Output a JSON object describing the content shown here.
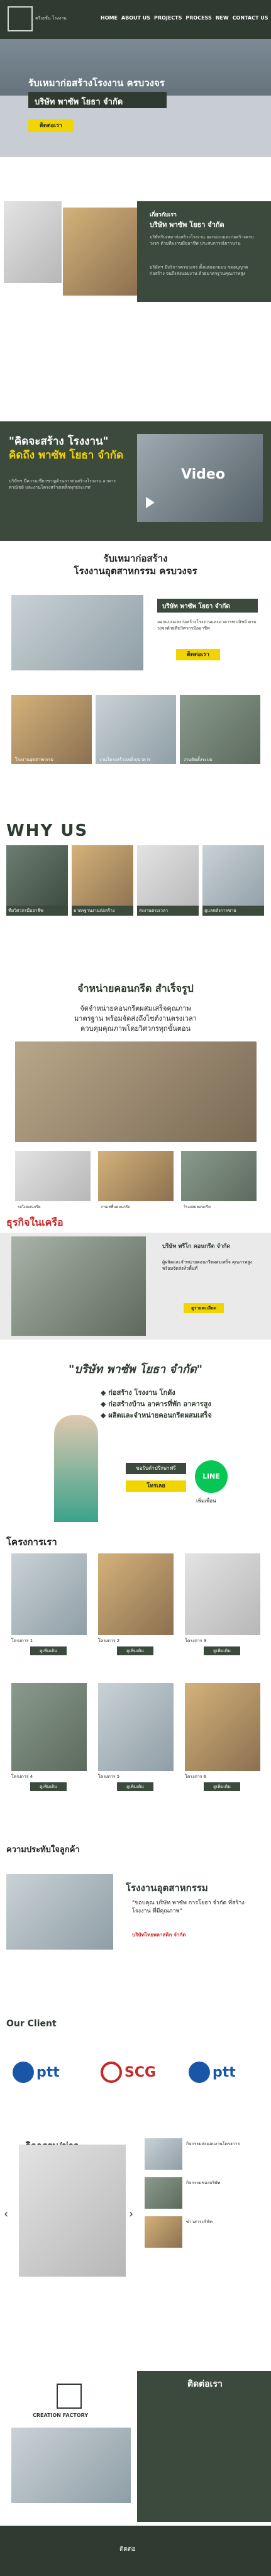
{
  "header": {
    "logo_text": "ครีเอชั่น โรงงาน",
    "nav": [
      "HOME",
      "ABOUT US",
      "PROJECTS",
      "PROCESS",
      "NEW",
      "CONTACT US"
    ]
  },
  "hero": {
    "title": "รับเหมาก่อสร้างโรงงาน ครบวงจร",
    "subtitle": "บริษัท พาซัพ โยธา จำกัด",
    "button": "ติดต่อเรา"
  },
  "about": {
    "heading": "เกี่ยวกับเรา",
    "company": "บริษัท พาซัพ โยธา จำกัด",
    "para1": "บริษัทรับเหมาก่อสร้างโรงงาน ออกแบบและก่อสร้างครบวงจร ด้วยทีมงานมืออาชีพ ประสบการณ์ยาวนาน",
    "para2": "บริษัทฯ มีบริการครบวงจร ตั้งแต่ออกแบบ ขออนุญาต ก่อสร้าง จนถึงส่งมอบงาน ด้วยมาตรฐานคุณภาพสูง"
  },
  "slogan": {
    "quote": "\"คิดจะสร้าง โรงงาน\"",
    "sub": "คิดถึง พาซัพ โยธา จำกัด",
    "para": "บริษัทฯ มีความเชี่ยวชาญด้านการก่อสร้างโรงงาน อาคารพาณิชย์ และงานโครงสร้างเหล็กทุกประเภท",
    "video_label": "Video"
  },
  "factory": {
    "title1": "รับเหมาก่อสร้าง",
    "title2": "โรงงานอุตสาหกรรม ครบวงจร",
    "company": "บริษัท พาซัพ โยธา จำกัด",
    "desc": "ออกแบบและก่อสร้างโรงงานและอาคารพาณิชย์ ครบวงจรด้วยทีมวิศวกรมืออาชีพ",
    "button": "ติดต่อเรา",
    "gallery": [
      "โรงงานอุตสาหกรรม",
      "งานโครงสร้างเหล็ก/อาคาร",
      "งานติดตั้งระบบ"
    ]
  },
  "why": {
    "title": "WHY US",
    "items": [
      {
        "text": "ทีมวิศวกรมืออาชีพ"
      },
      {
        "text": "มาตรฐานงานก่อสร้าง"
      },
      {
        "text": "ส่งงานตรงเวลา"
      },
      {
        "text": "ดูแลหลังการขาย"
      }
    ]
  },
  "concrete": {
    "title": "จำหน่ายคอนกรีต สำเร็จรูป",
    "desc1": "จัดจำหน่ายคอนกรีตผสมเสร็จคุณภาพ",
    "desc2": "มาตรฐาน พร้อมจัดส่งถึงไซต์งานตรงเวลา",
    "desc3": "ควบคุมคุณภาพโดยวิศวกรทุกขั้นตอน",
    "captions": [
      "รถโม่คอนกรีต",
      "งานเทพื้นคอนกรีต",
      "โรงผสมคอนกรีต"
    ],
    "cta_title": "ธุรกิจในเครือ",
    "sub_company": "บริษัท พรีโก คอนกรีต จำกัด",
    "sub_desc": "ผู้ผลิตและจำหน่ายคอนกรีตผสมเสร็จ คุณภาพสูง พร้อมจัดส่งทั่วพื้นที่",
    "cta_button": "ดูรายละเอียด"
  },
  "services": {
    "quote": "\"บริษัท พาซัพ โยธา จำกัด\"",
    "items": [
      "ก่อสร้าง โรงงาน โกดัง",
      "ก่อสร้างบ้าน อาคารที่พัก อาคารสูง",
      "ผลิตและจำหน่ายคอนกรีตผสมเสร็จ"
    ],
    "consult_btn": "ขอรับคำปรึกษาฟรี",
    "call_btn": "โทรเลย",
    "line_label": "LINE",
    "line_sub": "เพิ่มเพื่อน"
  },
  "projects": {
    "title": "โครงการเรา",
    "items": [
      {
        "caption": "โครงการ 1",
        "button": "ดูเพิ่มเติม"
      },
      {
        "caption": "โครงการ 2",
        "button": "ดูเพิ่มเติม"
      },
      {
        "caption": "โครงการ 3",
        "button": "ดูเพิ่มเติม"
      },
      {
        "caption": "โครงการ 4",
        "button": "ดูเพิ่มเติม"
      },
      {
        "caption": "โครงการ 5",
        "button": "ดูเพิ่มเติม"
      },
      {
        "caption": "โครงการ 6",
        "button": "ดูเพิ่มเติม"
      }
    ]
  },
  "testimonial": {
    "title": "ความประทับใจลูกค้า",
    "heading": "โรงงานอุตสาหกรรม",
    "quote": "\"ขอบคุณ บริษัท พาซัพ การโยธา จำกัด ที่สร้างโรงงาน ที่มีคุณภาพ\"",
    "author": "บริษัทไทยพลาสติก จำกัด"
  },
  "clients": {
    "title": "Our Client",
    "logos": [
      "ptt",
      "SCG",
      "ptt"
    ]
  },
  "news": {
    "title": "กิจกรรม/ข่าว",
    "items": [
      {
        "text": "กิจกรรมส่งมอบงานโครงการ"
      },
      {
        "text": "กิจกรรมของบริษัท"
      },
      {
        "text": "ข่าวสารบริษัท"
      }
    ]
  },
  "contact": {
    "title": "ติดต่อเรา",
    "brand": "CREATION FACTORY",
    "footer": "ติดต่อ"
  },
  "colors": {
    "green": "#3b4a3d",
    "yellow": "#f2d500",
    "red": "#c62828"
  }
}
